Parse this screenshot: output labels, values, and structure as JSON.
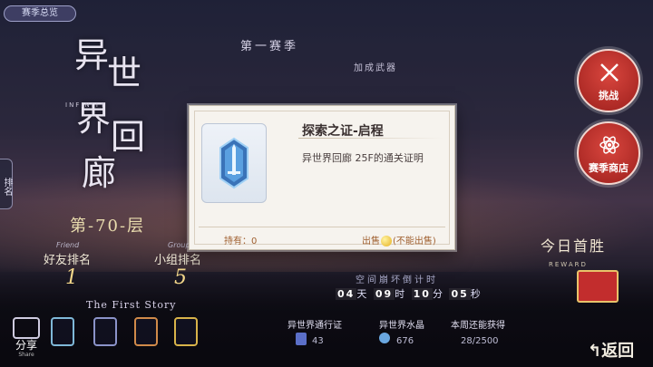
{
  "season_badge": "赛季总览",
  "title": {
    "chars": [
      "异",
      "世",
      "界",
      "回",
      "廊"
    ],
    "subtitle": "INFINITY"
  },
  "side_tab": "排名",
  "floor": "第-70-层",
  "rankings": {
    "friend_label": "好友排名",
    "friend_value": "1",
    "group_label": "小组排名",
    "group_value": "5",
    "sub_label": "Friend",
    "sub_label_2": "Group"
  },
  "first_story": "The First Story",
  "share": {
    "label": "分享",
    "sub": "Share"
  },
  "header": {
    "season": "第一赛季",
    "bonus_weapon": "加成武器"
  },
  "modal": {
    "item_name": "探索之证-启程",
    "item_desc": "异世界回廊 25F的通关证明",
    "owned": "持有：0",
    "sell_label": "出售",
    "sell_note": "(不能出售)"
  },
  "buttons": {
    "challenge": "挑战",
    "season_shop": "赛季商店",
    "return": "↰返回"
  },
  "first_win": {
    "title": "今日首胜",
    "reward": "REWARD"
  },
  "countdown": {
    "label": "空间崩坏倒计时",
    "days": "04",
    "days_unit": "天",
    "hours": "09",
    "hours_unit": "时",
    "minutes": "10",
    "minutes_unit": "分",
    "seconds": "05",
    "seconds_unit": "秒"
  },
  "stats": {
    "pass_label": "异世界通行证",
    "pass_value": "43",
    "crystal_label": "异世界水晶",
    "crystal_value": "676",
    "weekly_label": "本周还能获得",
    "weekly_value": "28/2500"
  },
  "colors": {
    "accent_red": "#c22d2d",
    "gold": "#f3d78a",
    "modal_bg": "#f6f3ee"
  }
}
